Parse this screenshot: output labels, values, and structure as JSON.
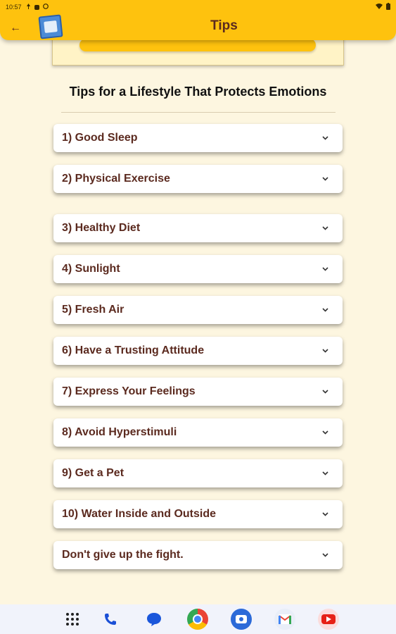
{
  "status_bar": {
    "time": "10:57"
  },
  "app_bar": {
    "title": "Tips",
    "back_glyph": "←"
  },
  "section": {
    "title": "Tips for a Lifestyle That Protects Emotions"
  },
  "tips": [
    {
      "label": "1) Good Sleep"
    },
    {
      "label": "2) Physical Exercise"
    },
    {
      "label": "3) Healthy Diet"
    },
    {
      "label": "4) Sunlight"
    },
    {
      "label": "5) Fresh Air"
    },
    {
      "label": "6) Have a Trusting Attitude"
    },
    {
      "label": "7) Express Your Feelings"
    },
    {
      "label": "8) Avoid Hyperstimuli"
    },
    {
      "label": "9) Get a Pet"
    },
    {
      "label": "10) Water Inside and Outside"
    },
    {
      "label": "Don't give up the fight."
    }
  ],
  "nav_apps": [
    "app-grid-icon",
    "phone-icon",
    "messages-icon",
    "chrome-icon",
    "camera-icon",
    "gmail-icon",
    "youtube-icon"
  ],
  "colors": {
    "appbar": "#FEC20E",
    "background": "#FDF6E0",
    "text": "#5B2A1F"
  }
}
